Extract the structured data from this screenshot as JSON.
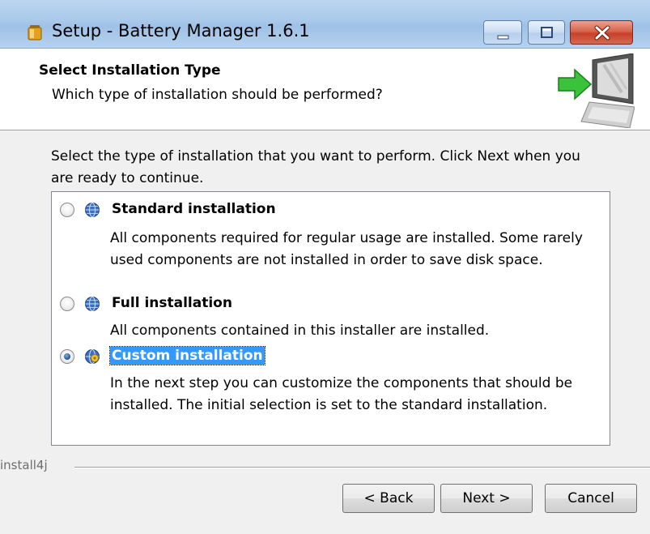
{
  "window": {
    "title": "Setup - Battery Manager 1.6.1"
  },
  "header": {
    "title": "Select Installation Type",
    "subtitle": "Which type of installation should be performed?"
  },
  "intro_text": "Select the type of installation that you want to perform. Click Next when you are ready to continue.",
  "options": [
    {
      "label": "Standard installation",
      "description": "All components required for regular usage are installed. Some rarely used components are not installed in order to save disk space.",
      "selected": false
    },
    {
      "label": "Full installation",
      "description": "All components contained in this installer are installed.",
      "selected": false
    },
    {
      "label": "Custom installation",
      "description": "In the next step you can customize the components that should be installed. The initial selection is set to the standard installation.",
      "selected": true
    }
  ],
  "footer": {
    "brand": "install4j",
    "back_label": "< Back",
    "next_label": "Next >",
    "cancel_label": "Cancel"
  },
  "colors": {
    "selection_highlight": "#3399ff",
    "close_button": "#c7402a"
  }
}
